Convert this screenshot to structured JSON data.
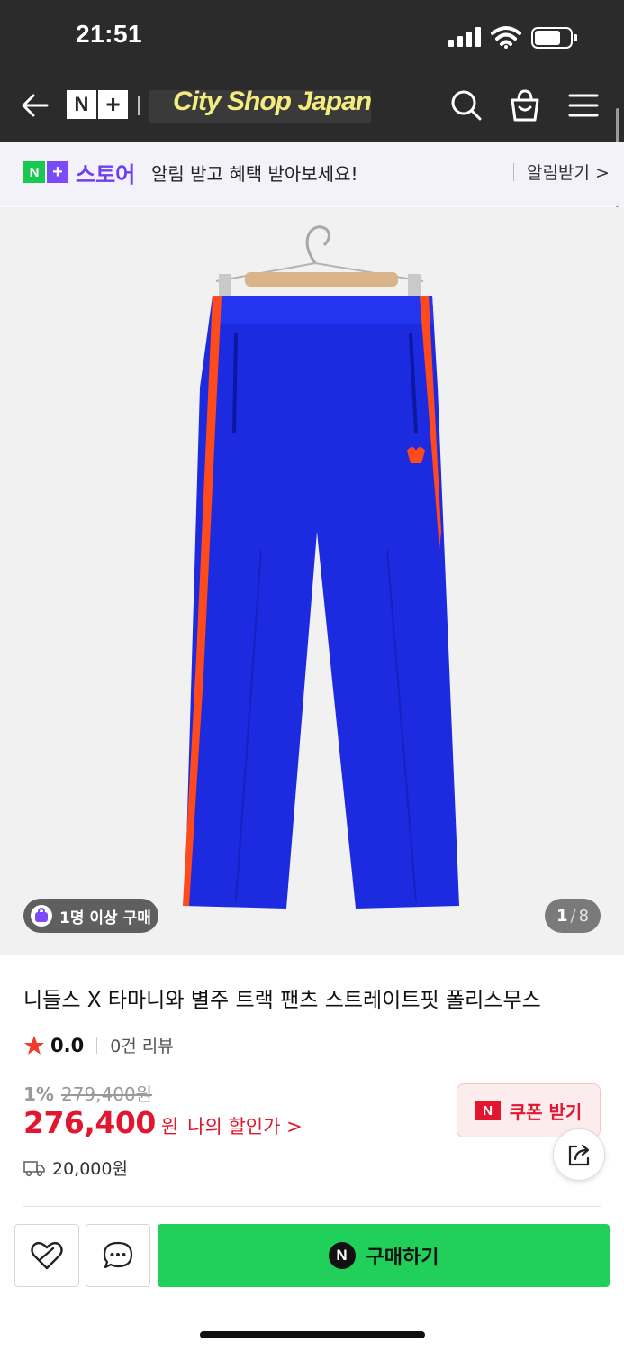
{
  "status_bar": {
    "time": "21:51"
  },
  "header": {
    "logo": {
      "n": "N",
      "plus": "+"
    },
    "shop_name": "City Shop Japan",
    "icons": [
      "back-arrow-icon",
      "search-icon",
      "shopping-bag-icon",
      "menu-icon"
    ]
  },
  "promo": {
    "logo": {
      "n": "N",
      "plus": "+"
    },
    "store": "스토어",
    "message": "알림 받고 혜택 받아보세요!",
    "cta": "알림받기 >"
  },
  "gallery": {
    "buyer_badge": "1명 이상 구매",
    "current": "1",
    "total": "8",
    "separator": "/",
    "colors": {
      "pants": "#1c2be0",
      "stripe": "#ff4a1c",
      "background": "#f1f1f1"
    }
  },
  "product": {
    "title": "니들스 X 타마니와 별주 트랙 팬츠 스트레이트핏 폴리스무스",
    "rating": "0.0",
    "reviews": "0건 리뷰",
    "discount_percent": "1%",
    "original_price": "279,400원",
    "price": "276,400",
    "currency": "원",
    "my_discount": "나의 할인가 >",
    "shipping_fee": "20,000원"
  },
  "coupon": {
    "icon_label": "N",
    "label": "쿠폰 받기"
  },
  "actions": {
    "buy_icon_label": "N",
    "buy_label": "구매하기"
  },
  "colors": {
    "accent_red": "#e1162f",
    "buy_green": "#21d05a",
    "store_purple": "#6c3ff0",
    "header_bg": "#2b2b2b"
  }
}
